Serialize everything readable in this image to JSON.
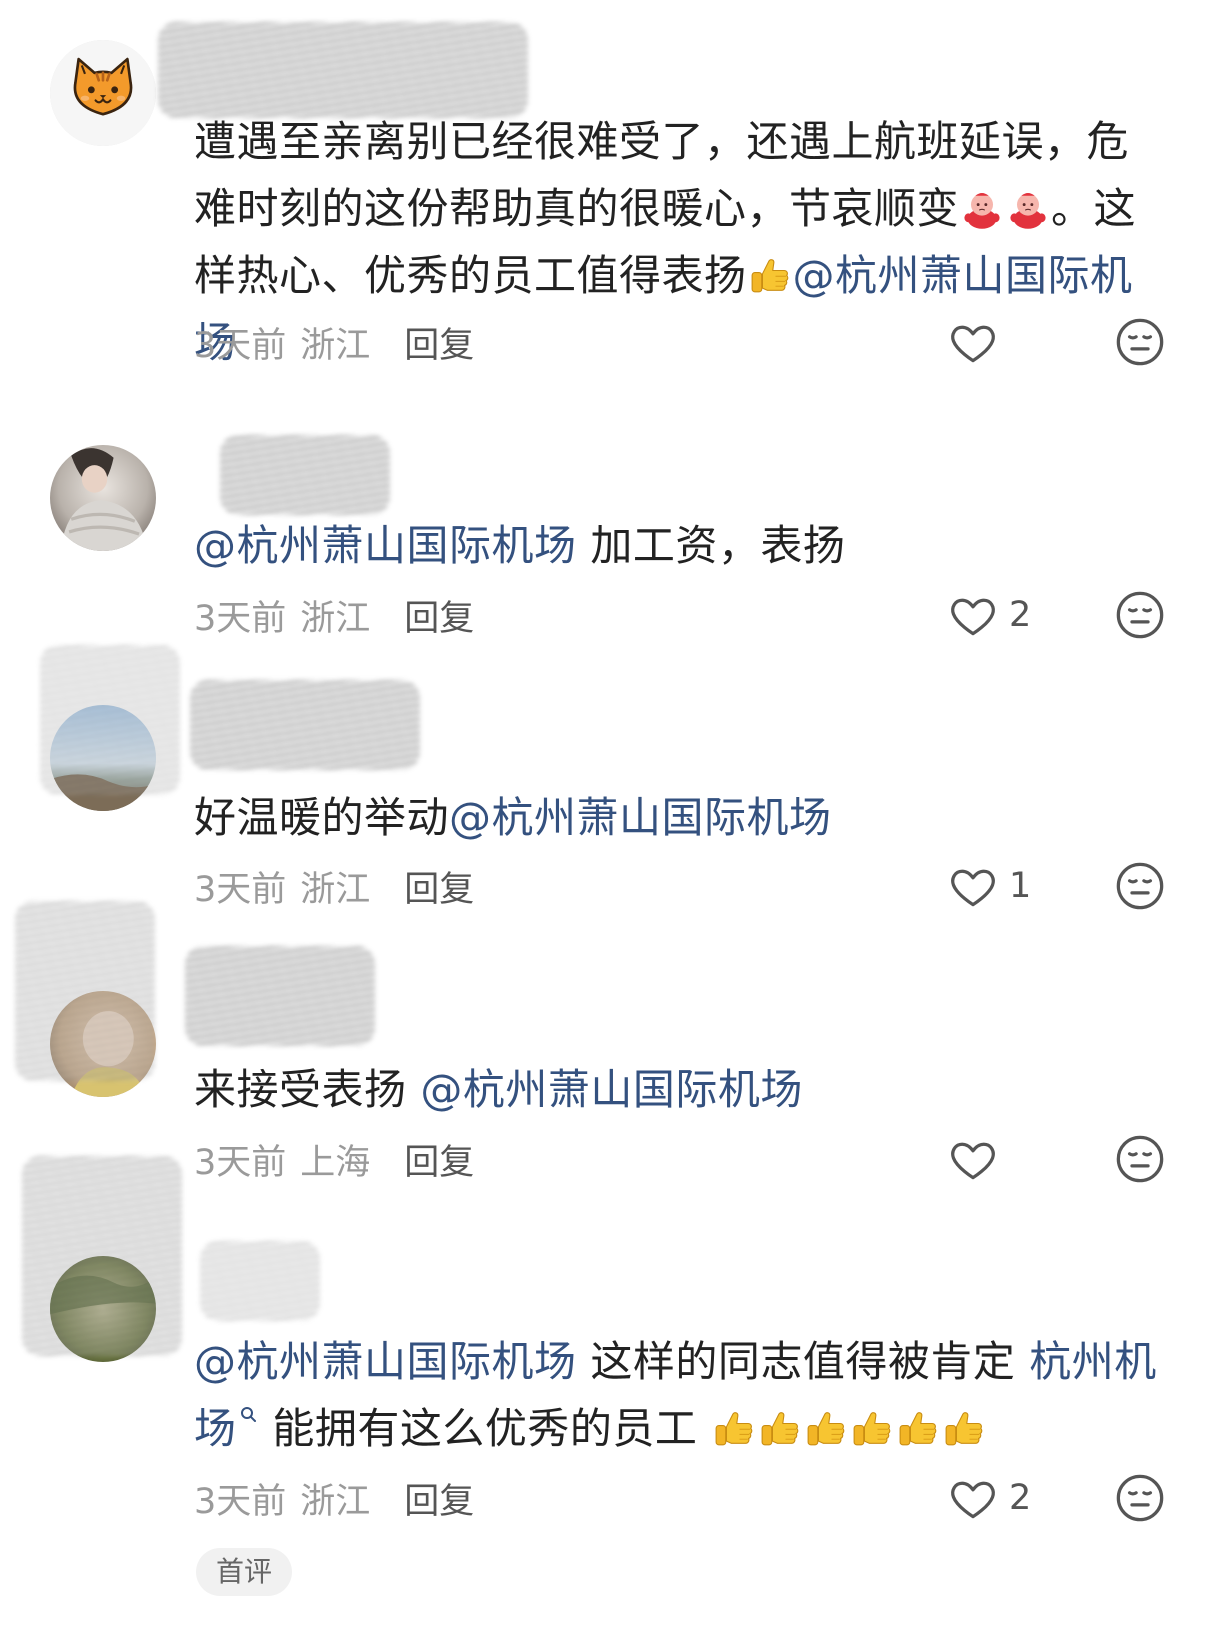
{
  "colors": {
    "text": "#222222",
    "mention": "#34517f",
    "meta": "#9a9a9a",
    "reply": "#555555",
    "icon": "#555555",
    "badge_bg": "#f1f1f1"
  },
  "comments": [
    {
      "avatar_icon": "cat-face-icon",
      "text_1": "遭遇至亲离别已经很难受了，还遇上航班延误，危难时刻的这份帮助真的很暖心，节哀顺变",
      "emoji_1": [
        "sad-blob-emoji",
        "sad-blob-emoji"
      ],
      "text_2": "。这样热心、优秀的员工值得表扬",
      "emoji_2": [
        "thumbs-up-emoji"
      ],
      "mention": "@杭州萧山国际机场",
      "time": "3天前",
      "location": "浙江",
      "reply": "回复",
      "icons": [
        "heart-outline-icon",
        "dislike-face-icon"
      ]
    },
    {
      "avatar_icon": "photo-avatar",
      "mention": "@杭州萧山国际机场",
      "text_1": " 加工资，表扬",
      "time": "3天前",
      "location": "浙江",
      "reply": "回复",
      "like_count": "2",
      "icons": [
        "heart-outline-icon",
        "dislike-face-icon"
      ]
    },
    {
      "avatar_icon": "photo-avatar",
      "text_1": "好温暖的举动",
      "mention": "@杭州萧山国际机场",
      "time": "3天前",
      "location": "浙江",
      "reply": "回复",
      "like_count": "1",
      "icons": [
        "heart-outline-icon",
        "dislike-face-icon"
      ]
    },
    {
      "avatar_icon": "photo-avatar",
      "text_1": "来接受表扬 ",
      "mention": "@杭州萧山国际机场",
      "time": "3天前",
      "location": "上海",
      "reply": "回复",
      "icons": [
        "heart-outline-icon",
        "dislike-face-icon"
      ]
    },
    {
      "avatar_icon": "photo-avatar",
      "mention": "@杭州萧山国际机场",
      "text_1": "  这样的同志值得被肯定  ",
      "search_link": "杭州机场",
      "text_2": " 能拥有这么优秀的员工  ",
      "emoji_1": [
        "thumbs-up-emoji",
        "thumbs-up-emoji",
        "thumbs-up-emoji",
        "thumbs-up-emoji",
        "thumbs-up-emoji",
        "thumbs-up-emoji"
      ],
      "time": "3天前",
      "location": "浙江",
      "reply": "回复",
      "like_count": "2",
      "badge": "首评",
      "icons": [
        "heart-outline-icon",
        "dislike-face-icon",
        "search-icon"
      ]
    }
  ]
}
